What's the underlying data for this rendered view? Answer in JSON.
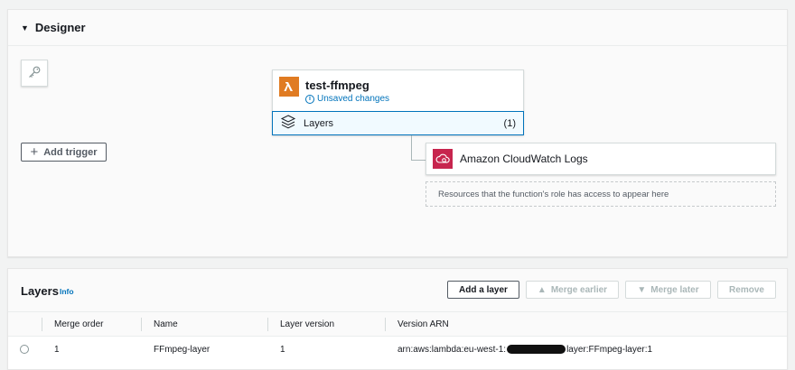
{
  "designer": {
    "title": "Designer",
    "add_trigger_label": "Add trigger",
    "function": {
      "name": "test-ffmpeg",
      "status": "Unsaved changes",
      "layers_label": "Layers",
      "layers_count": "(1)"
    },
    "destination": {
      "name": "Amazon CloudWatch Logs",
      "resources_hint": "Resources that the function's role has access to appear here"
    },
    "colors": {
      "lambda_orange": "#e07b22",
      "cloudwatch_pink": "#c7254e",
      "link_blue": "#0073bb"
    }
  },
  "layers_panel": {
    "title": "Layers",
    "info_link": "Info",
    "buttons": {
      "add_layer": "Add a layer",
      "merge_earlier": "Merge earlier",
      "merge_later": "Merge later",
      "remove": "Remove"
    },
    "columns": [
      "Merge order",
      "Name",
      "Layer version",
      "Version ARN"
    ],
    "rows": [
      {
        "merge_order": "1",
        "name": "FFmpeg-layer",
        "layer_version": "1",
        "arn_prefix": "arn:aws:lambda:eu-west-1:",
        "arn_suffix": "layer:FFmpeg-layer:1"
      }
    ]
  },
  "icons": [
    "caret-down-icon",
    "key-icon",
    "plus-icon",
    "lambda-icon",
    "info-icon",
    "layers-icon",
    "cloudwatch-icon",
    "triangle-up-icon",
    "triangle-down-icon"
  ]
}
